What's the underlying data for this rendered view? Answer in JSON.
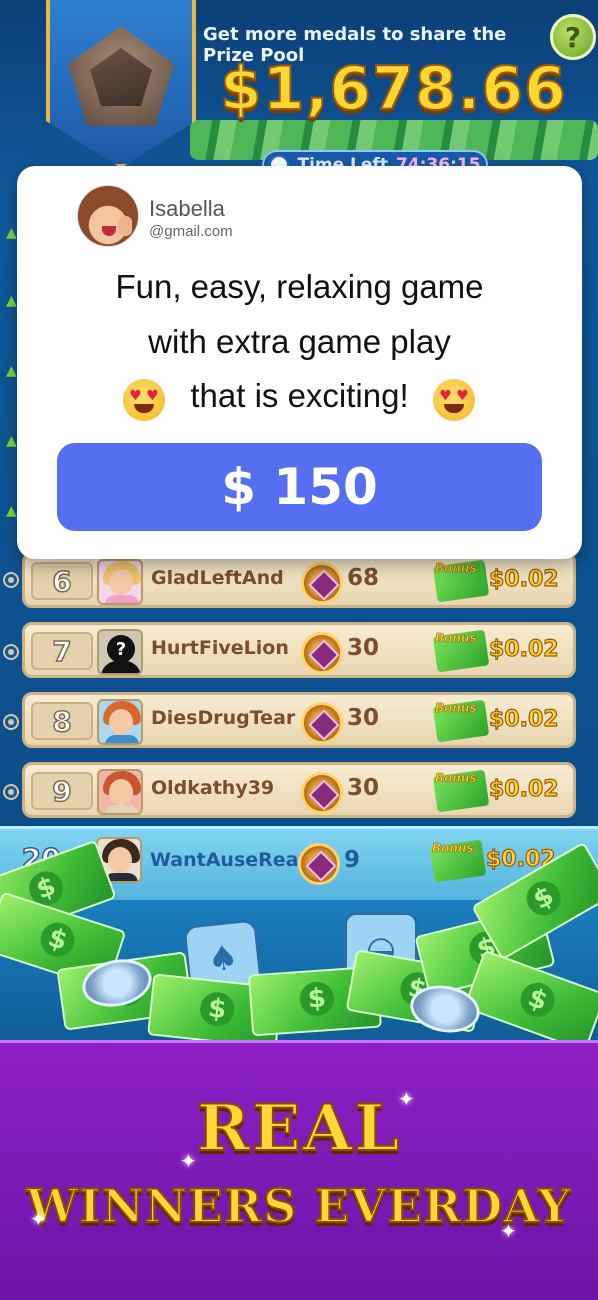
{
  "prize_banner": {
    "hint": "Get more medals to share the Prize Pool",
    "amount": "$1,678.66",
    "help_label": "?",
    "time_left_label": "Time Left",
    "time_left_value": "74:36:15"
  },
  "review": {
    "name": "Isabella",
    "email": "@gmail.com",
    "line1": "Fun, easy, relaxing game",
    "line2": "with extra game play",
    "line3": "that is exciting!",
    "reward": "$ 150"
  },
  "leaderboard": {
    "bonus_label": "Bonus",
    "rows": [
      {
        "rank": "6",
        "name": "GladLeftAnd",
        "medals": "68",
        "bonus": "$0.02"
      },
      {
        "rank": "7",
        "name": "HurtFiveLion",
        "medals": "30",
        "bonus": "$0.02"
      },
      {
        "rank": "8",
        "name": "DiesDrugTear",
        "medals": "30",
        "bonus": "$0.02"
      },
      {
        "rank": "9",
        "name": "Oldkathy39",
        "medals": "30",
        "bonus": "$0.02"
      }
    ],
    "self": {
      "rank": "20+",
      "name": "WantAuseReap",
      "medals": "9",
      "bonus": "$0.02"
    }
  },
  "slogan": {
    "line1": "REAL",
    "line2": "WINNERS EVERDAY"
  },
  "colors": {
    "prize_gold": "#ffd735",
    "reward_button": "#566ef0",
    "slogan_panel": "#8e1fc5"
  }
}
